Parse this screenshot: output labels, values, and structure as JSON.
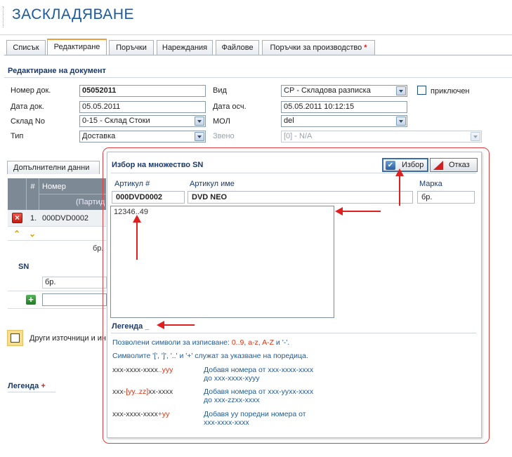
{
  "app": {
    "title": "ЗАСКЛАДЯВАНЕ"
  },
  "tabs": [
    {
      "label": "Списък"
    },
    {
      "label": "Редактиране"
    },
    {
      "label": "Поръчки"
    },
    {
      "label": "Нареждания"
    },
    {
      "label": "Файлове"
    },
    {
      "label": "Поръчки за производство",
      "marker": "*"
    }
  ],
  "form": {
    "section_title": "Редактиране на документ",
    "doc_no_label": "Номер док.",
    "doc_no": "05052011",
    "doc_date_label": "Дата док.",
    "doc_date": "05.05.2011",
    "warehouse_label": "Склад No",
    "warehouse": "0-15 - Склад Стоки",
    "type_label": "Тип",
    "type": "Доставка",
    "kind_label": "Вид",
    "kind": "СР - Складова разписка",
    "post_date_label": "Дата осч.",
    "post_date": "05.05.2011 10:12:15",
    "mol_label": "МОЛ",
    "mol": "del",
    "link_label": "Звено",
    "link": "[0] - N/A",
    "closed_label": "приключен"
  },
  "grid": {
    "extra_tab": "Допълнителни данни",
    "col_index": "#",
    "col_number": "Номер",
    "col_batch": "(Партид",
    "row_index": "1.",
    "row_code": "000DVD0002",
    "sn_label": "SN",
    "unit": "бр.",
    "unit2": "бр."
  },
  "other_sources_label": "Други източници и ин",
  "legend_below": {
    "label": "Легенда",
    "marker": "+"
  },
  "modal": {
    "title": "Избор на множество SN",
    "select_label": "Избор",
    "cancel_label": "Отказ",
    "article_no_label": "Артикул #",
    "article_no": "000DVD0002",
    "article_name_label": "Артикул име",
    "article_name": "DVD NEO",
    "brand_label": "Марка",
    "brand": "бр.",
    "sn_text": "12346..49",
    "legend": {
      "title": "Легенда",
      "marker": "_",
      "allowed_prefix": "Позволени символи за изписване: ",
      "allowed_1": "0..9",
      "allowed_sep1": ", ",
      "allowed_2": "a-z",
      "allowed_sep2": ", ",
      "allowed_3": "A-Z",
      "allowed_sep3": " и ",
      "allowed_4": "'-'",
      "allowed_end": ".",
      "symbols_line": "Символите '[', ']', '..' и '+' служат за указване на поредица.",
      "ex1_a": "xxx-xxxx-xxxx",
      "ex1_b": "..yyy",
      "ex1_desc1": "Добавя номера от xxx-xxxx-xxxx",
      "ex1_desc2": "до xxx-xxxx-xyyy",
      "ex2_a": "xxx-",
      "ex2_b": "[yy..zz]",
      "ex2_c": "xx-xxxx",
      "ex2_desc1": "Добавя номера от xxx-yyxx-xxxx",
      "ex2_desc2": "до xxx-zzxx-xxxx",
      "ex3_a": "xxx-xxxx-xxxx",
      "ex3_b": "+yy",
      "ex3_desc1": "Добавя yy поредни номера от",
      "ex3_desc2": "xxx-xxxx-xxxx"
    }
  }
}
